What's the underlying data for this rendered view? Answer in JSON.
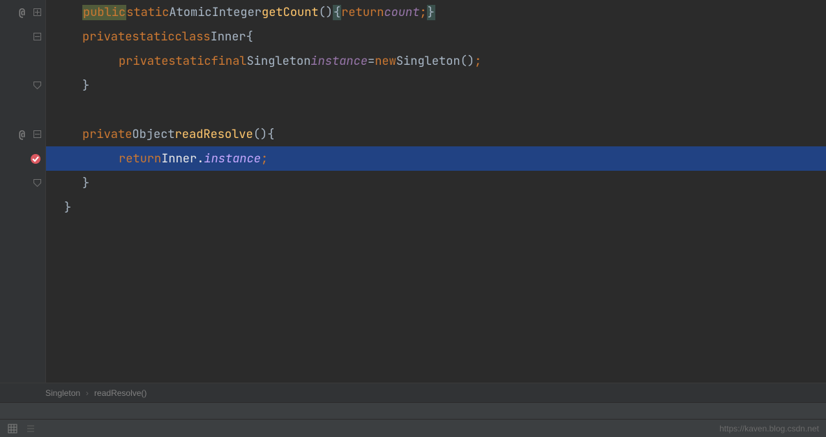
{
  "code": {
    "line1": {
      "public": "public",
      "static": "static",
      "type": "AtomicInteger",
      "method": "getCount",
      "parens": "()",
      "lbrace": "{",
      "return": "return",
      "field": "count",
      "semi": ";",
      "rbrace": "}"
    },
    "line2": {
      "private": "private",
      "static": "static",
      "class_kw": "class",
      "name": "Inner",
      "lbrace": "{"
    },
    "line3": {
      "private": "private",
      "static": "static",
      "final": "final",
      "type": "Singleton",
      "field": "instance",
      "eq": "=",
      "new": "new",
      "ctor": "Singleton",
      "parens": "()",
      "semi": ";"
    },
    "line4": {
      "rbrace": "}"
    },
    "line6": {
      "private": "private",
      "type": "Object",
      "method": "readResolve",
      "parens": "()",
      "lbrace": "{"
    },
    "line7": {
      "return": "return",
      "qualifier": "Inner",
      "dot": ".",
      "field": "instance",
      "semi": ";"
    },
    "line8": {
      "rbrace": "}"
    },
    "line9": {
      "rbrace": "}"
    }
  },
  "breadcrumb": {
    "class": "Singleton",
    "method": "readResolve()"
  },
  "status": {
    "watermark": "https://kaven.blog.csdn.net"
  },
  "icons": {
    "at": "at-icon",
    "expand": "expand-icon",
    "collapse": "collapse-icon",
    "close_fold": "close-fold-icon",
    "error": "error-icon",
    "grid": "grid-icon",
    "structure": "structure-icon"
  }
}
